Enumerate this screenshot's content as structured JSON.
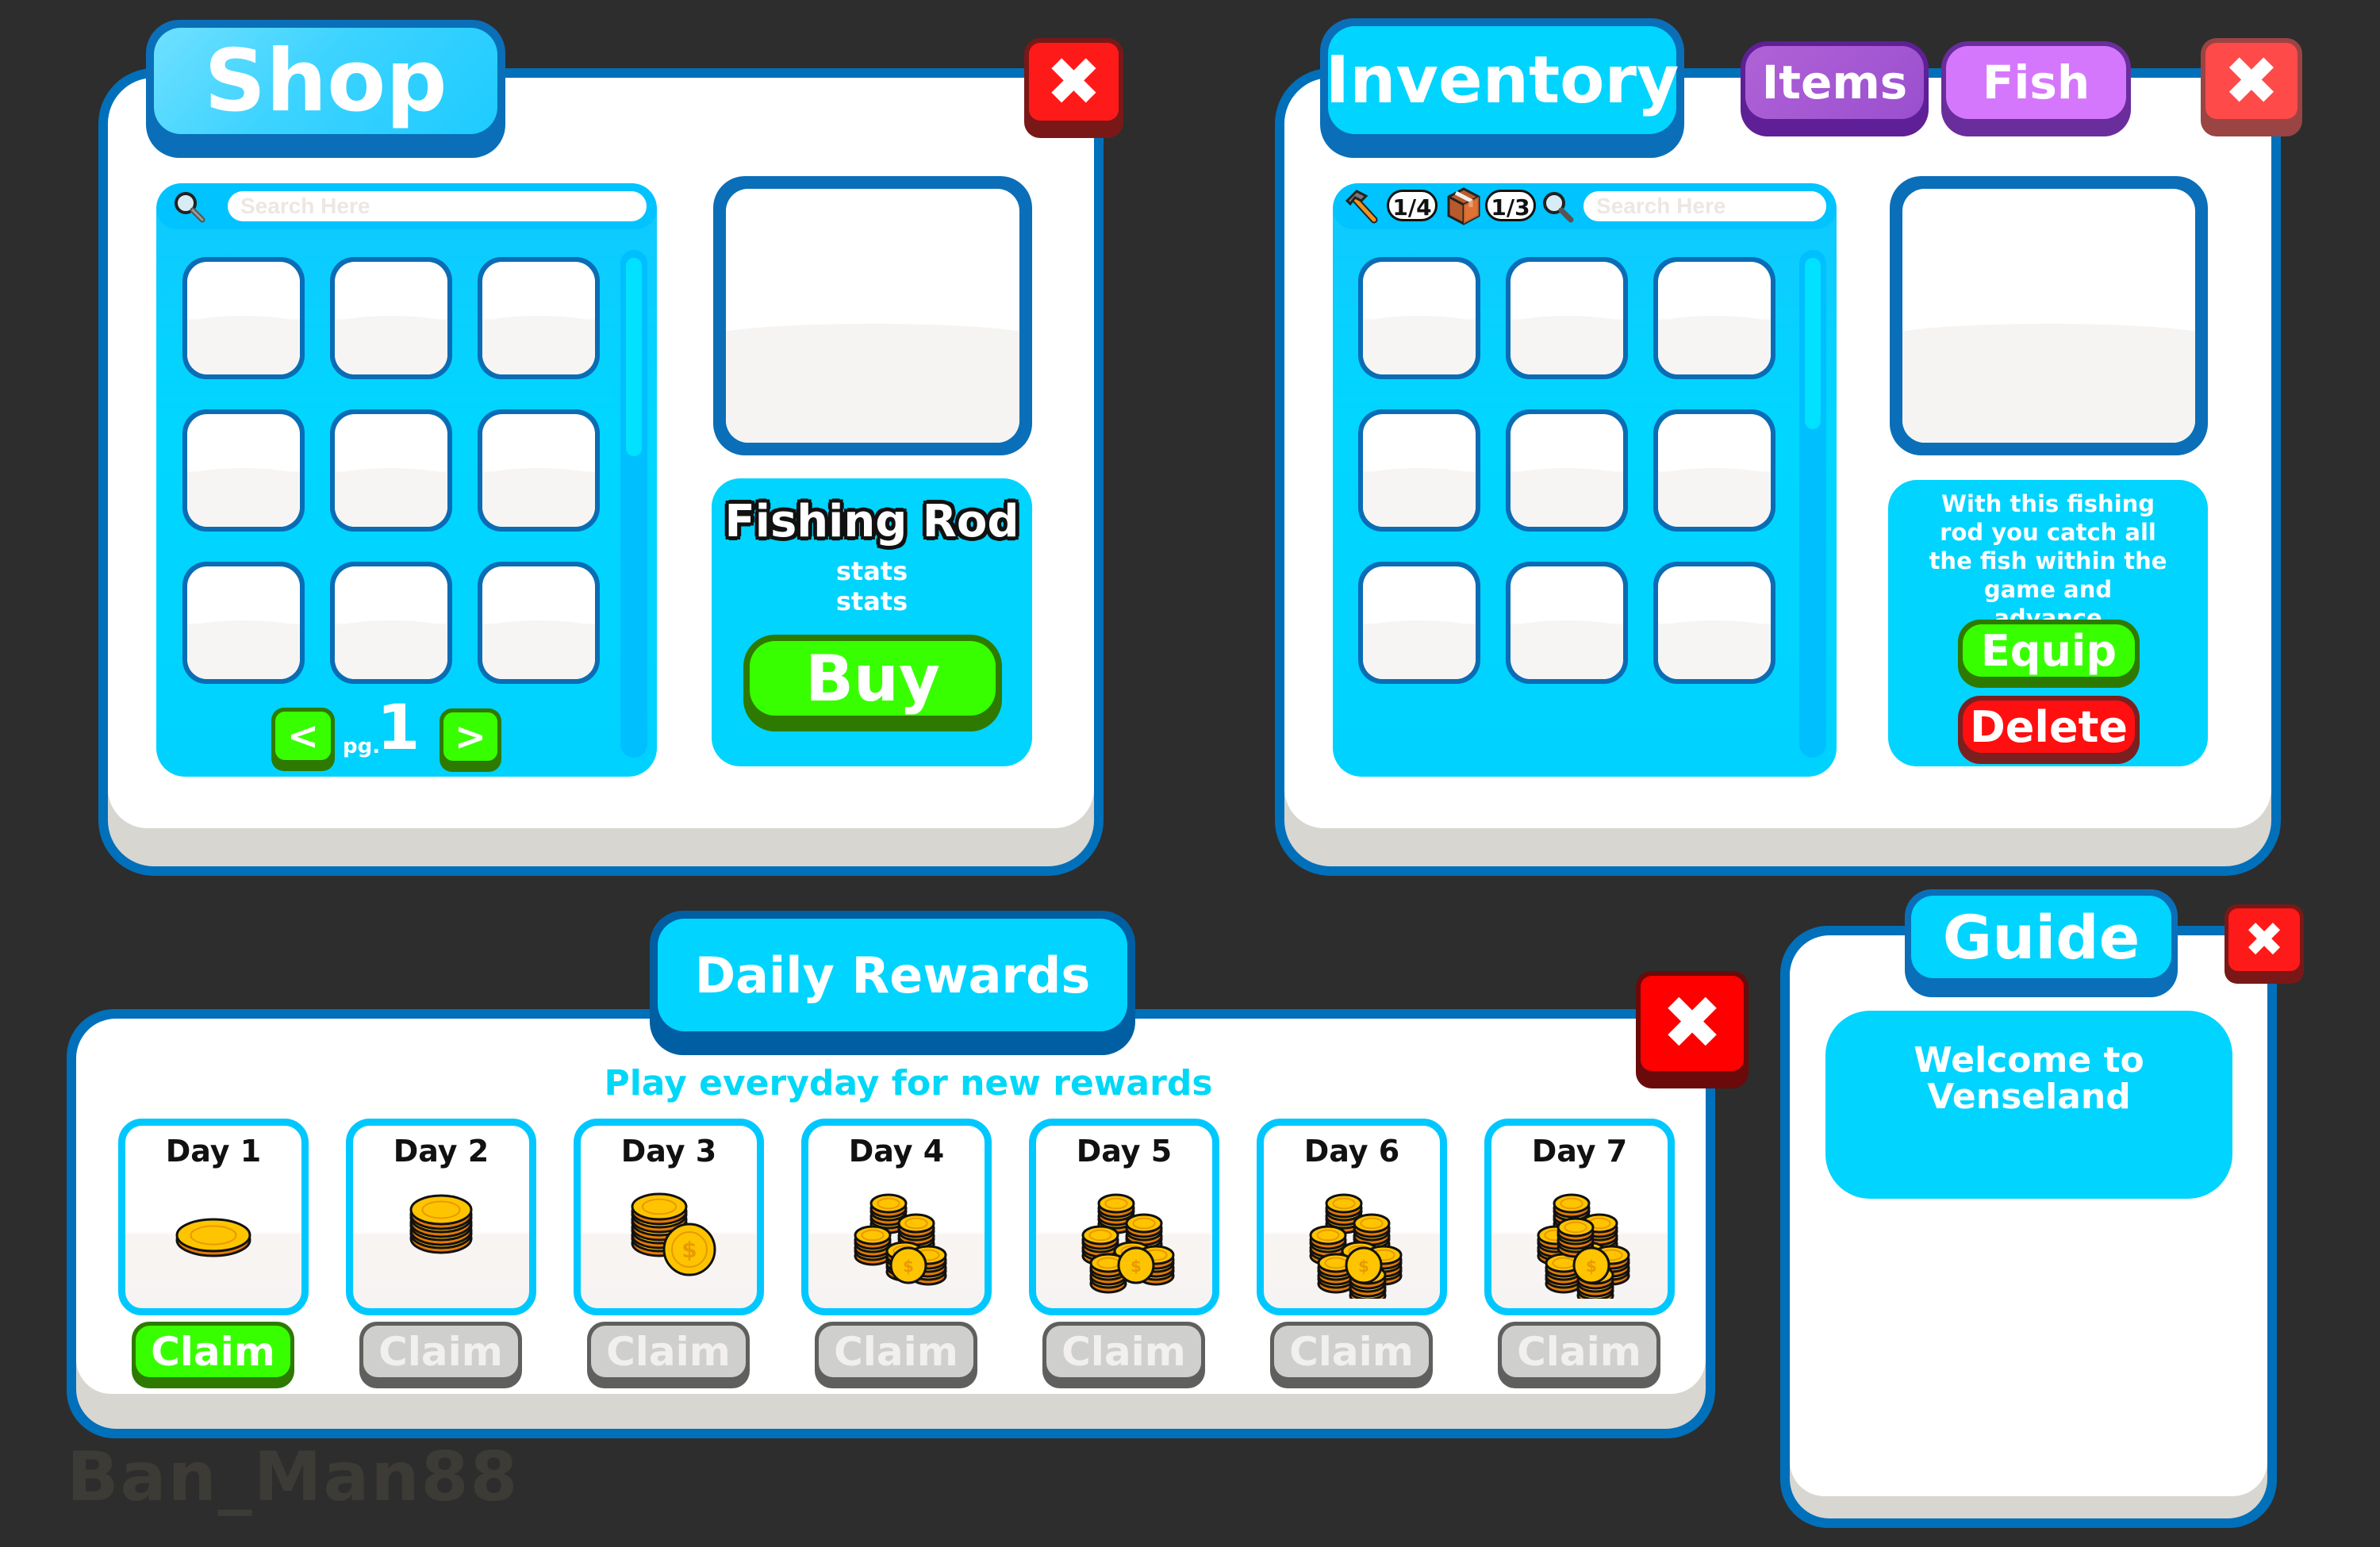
{
  "shop": {
    "title": "Shop",
    "close_icon": "close-icon",
    "search_placeholder": "Search Here",
    "search_icon": "magnifier-icon",
    "slot_count": 9,
    "pagination": {
      "prev_label": "<",
      "page_prefix": "pg.",
      "page_number": "1",
      "next_label": ">"
    },
    "item": {
      "name": "Fishing Rod",
      "stat_lines": [
        "stats",
        "stats"
      ]
    },
    "buy_label": "Buy"
  },
  "inventory": {
    "title": "Inventory",
    "tabs": [
      {
        "label": "Items"
      },
      {
        "label": "Fish"
      }
    ],
    "close_icon": "close-icon",
    "counters": [
      {
        "icon": "hammer-icon",
        "value": "1/4"
      },
      {
        "icon": "box-icon",
        "value": "1/3"
      }
    ],
    "search_icon": "magnifier-icon",
    "search_placeholder": "Search Here",
    "slot_count": 9,
    "description": "With this fishing rod you catch all the fish within the game and advance",
    "equip_label": "Equip",
    "delete_label": "Delete"
  },
  "daily_rewards": {
    "title": "Daily Rewards",
    "subtitle": "Play everyday for new rewards",
    "close_icon": "close-icon",
    "days": [
      {
        "label": "Day 1",
        "claim_label": "Claim",
        "claimable": true,
        "reward_icon": "single-coin-icon"
      },
      {
        "label": "Day 2",
        "claim_label": "Claim",
        "claimable": false,
        "reward_icon": "coin-stack-icon"
      },
      {
        "label": "Day 3",
        "claim_label": "Claim",
        "claimable": false,
        "reward_icon": "coin-stack-icon"
      },
      {
        "label": "Day 4",
        "claim_label": "Claim",
        "claimable": false,
        "reward_icon": "coin-pile-icon"
      },
      {
        "label": "Day 5",
        "claim_label": "Claim",
        "claimable": false,
        "reward_icon": "coin-pile-icon"
      },
      {
        "label": "Day 6",
        "claim_label": "Claim",
        "claimable": false,
        "reward_icon": "coin-pile-icon"
      },
      {
        "label": "Day 7",
        "claim_label": "Claim",
        "claimable": false,
        "reward_icon": "coin-pile-icon"
      }
    ]
  },
  "guide": {
    "title": "Guide",
    "close_icon": "close-icon",
    "message": "Welcome to Venseland"
  },
  "watermark": "Ban_Man88",
  "colors": {
    "background": "#2d2d2d",
    "panel_outline": "#0070ba",
    "panel_face": "#ffffff",
    "accent_cyan": "#00d4ff",
    "subtitle_cyan": "#00d8f8",
    "close_red": "#ff1a1a",
    "buy_green": "#38ff00",
    "delete_red": "#ff0f0f",
    "items_purple": "#a757d3",
    "fish_purple": "#d577fc",
    "claim_disabled": "#cfcfcd"
  }
}
